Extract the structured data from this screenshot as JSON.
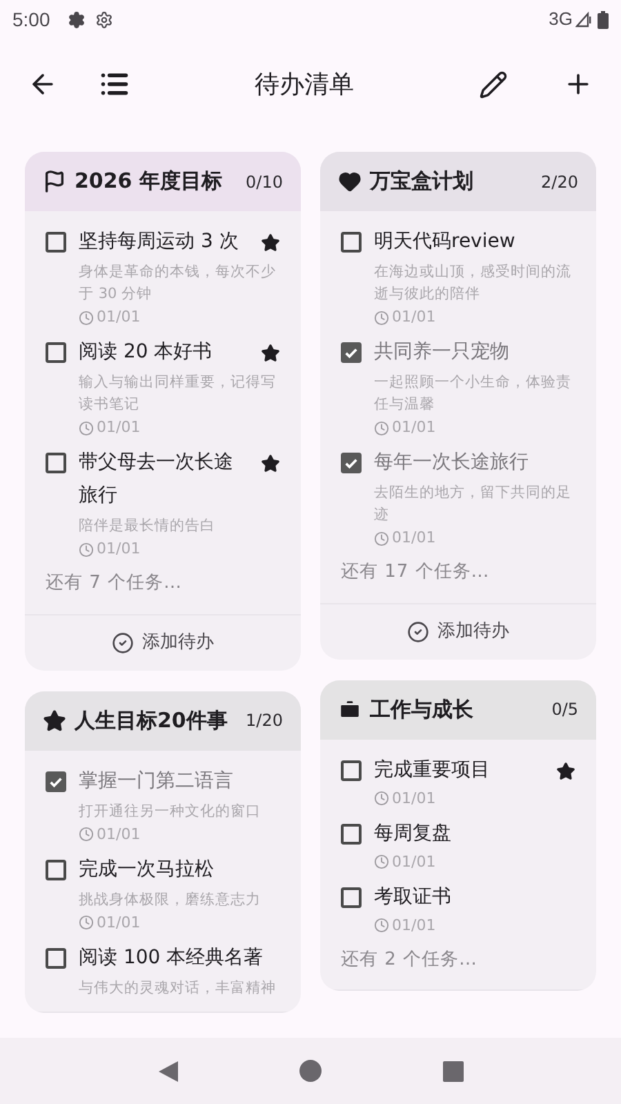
{
  "status_bar": {
    "time": "5:00",
    "network": "3G"
  },
  "toolbar": {
    "title": "待办清单"
  },
  "columns": [
    {
      "lists": [
        {
          "kind": "flag",
          "title": "2026 年度目标",
          "count": "0/10",
          "color": "#ece1ee",
          "items": [
            {
              "title": "坚持每周运动 3 次",
              "desc": "身体是革命的本钱，每次不少于 30 分钟",
              "date": "01/01",
              "checked": false,
              "starred": true
            },
            {
              "title": "阅读 20 本好书",
              "desc": "输入与输出同样重要，记得写读书笔记",
              "date": "01/01",
              "checked": false,
              "starred": true
            },
            {
              "title": "带父母去一次长途旅行",
              "desc": "陪伴是最长情的告白",
              "date": "01/01",
              "checked": false,
              "starred": true
            }
          ],
          "more": "还有 7 个任务…",
          "add_label": "添加待办"
        },
        {
          "kind": "star",
          "title": "人生目标20件事",
          "count": "1/20",
          "color": "#e5e3e6",
          "items": [
            {
              "title": "掌握一门第二语言",
              "desc": "打开通往另一种文化的窗口",
              "date": "01/01",
              "checked": true,
              "starred": false
            },
            {
              "title": "完成一次马拉松",
              "desc": "挑战身体极限，磨练意志力",
              "date": "01/01",
              "checked": false,
              "starred": false
            },
            {
              "title": "阅读 100 本经典名著",
              "desc": "与伟大的灵魂对话，丰富精神",
              "checked": false,
              "starred": false
            }
          ]
        }
      ]
    },
    {
      "lists": [
        {
          "kind": "heart",
          "title": "万宝盒计划",
          "count": "2/20",
          "color": "#e6e1e8",
          "items": [
            {
              "title": "明天代码review",
              "desc": "在海边或山顶，感受时间的流逝与彼此的陪伴",
              "date": "01/01",
              "checked": false,
              "starred": false
            },
            {
              "title": "共同养一只宠物",
              "desc": "一起照顾一个小生命，体验责任与温馨",
              "date": "01/01",
              "checked": true,
              "starred": false
            },
            {
              "title": "每年一次长途旅行",
              "desc": "去陌生的地方，留下共同的足迹",
              "date": "01/01",
              "checked": true,
              "starred": false
            }
          ],
          "more": "还有 17 个任务…",
          "add_label": "添加待办"
        },
        {
          "kind": "briefcase",
          "title": "工作与成长",
          "count": "0/5",
          "color": "#e4e3e4",
          "items": [
            {
              "title": "完成重要项目",
              "date": "01/01",
              "checked": false,
              "starred": true
            },
            {
              "title": "每周复盘",
              "date": "01/01",
              "checked": false,
              "starred": false
            },
            {
              "title": "考取证书",
              "date": "01/01",
              "checked": false,
              "starred": false
            }
          ],
          "more": "还有 2 个任务…"
        }
      ]
    }
  ]
}
